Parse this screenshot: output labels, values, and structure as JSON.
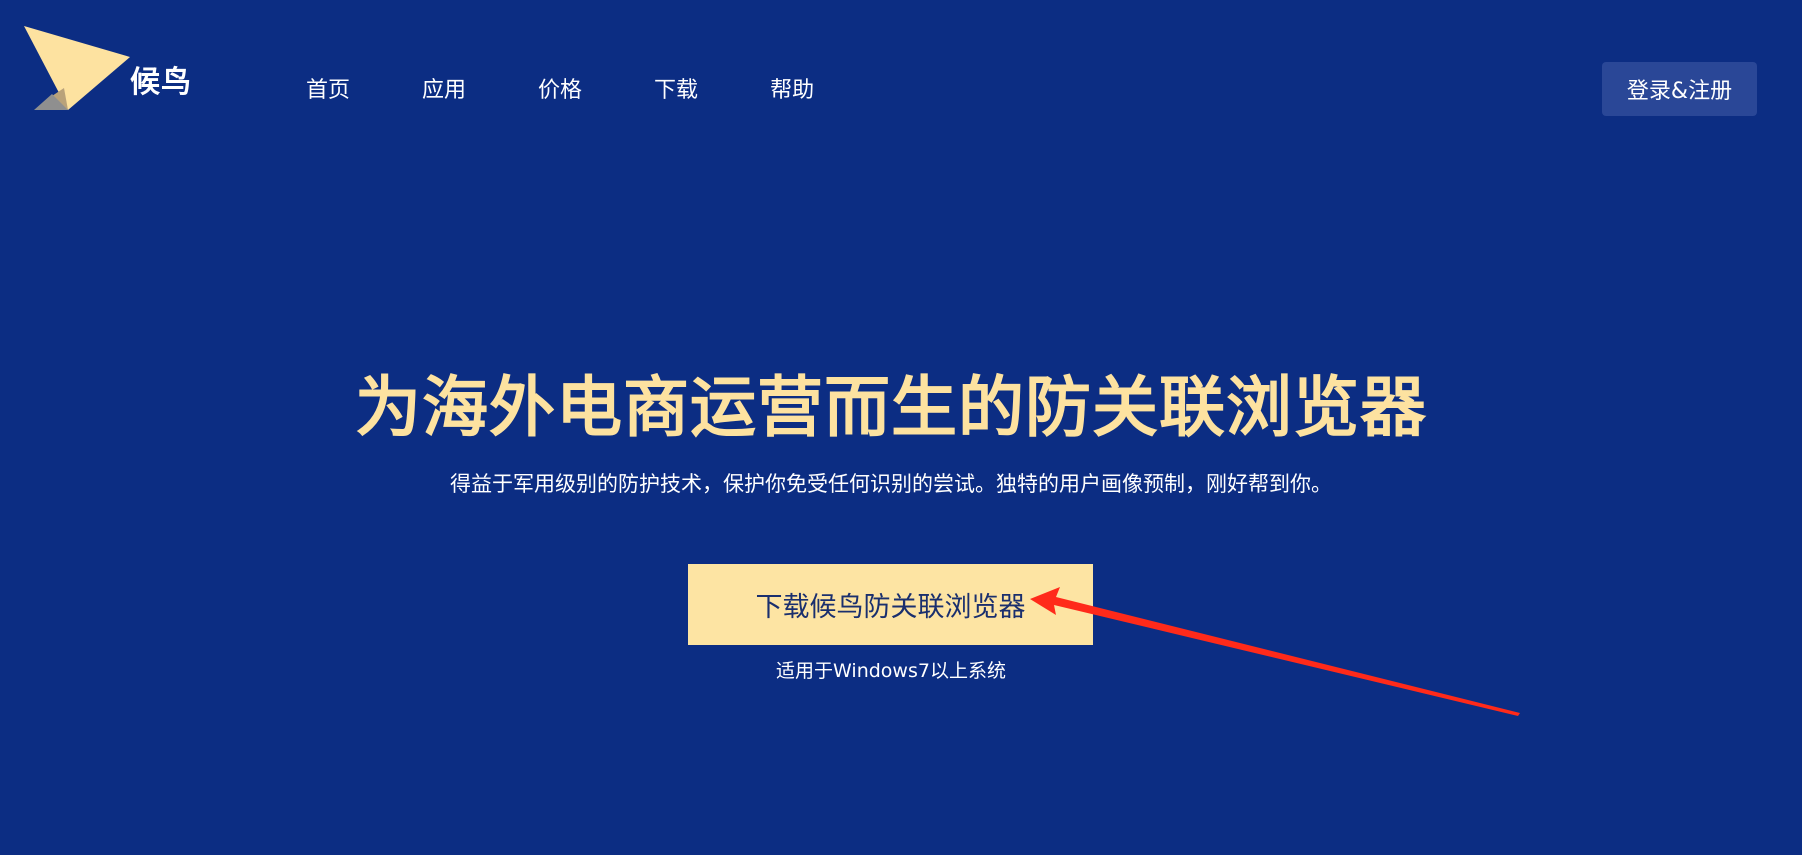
{
  "brand": {
    "name": "候鸟"
  },
  "nav": {
    "items": [
      {
        "label": "首页"
      },
      {
        "label": "应用"
      },
      {
        "label": "价格"
      },
      {
        "label": "下载"
      },
      {
        "label": "帮助"
      }
    ]
  },
  "header": {
    "login_label": "登录&注册"
  },
  "hero": {
    "title": "为海外电商运营而生的防关联浏览器",
    "subtitle": "得益于军用级别的防护技术，保护你免受任何识别的尝试。独特的用户画像预制，刚好帮到你。",
    "download_label": "下载候鸟防关联浏览器",
    "download_note": "适用于Windows7以上系统"
  },
  "colors": {
    "background": "#0c2d83",
    "accent": "#fde2a0",
    "button_bg": "#2a4797",
    "annotation_arrow": "#ff2a1a"
  },
  "icons": {
    "logo": "bird-wing-logo-icon",
    "arrow": "red-annotation-arrow"
  }
}
